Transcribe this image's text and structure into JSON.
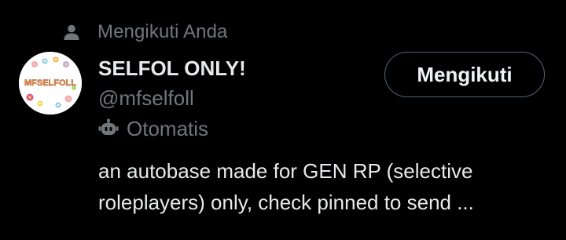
{
  "social_context": {
    "icon": "person-icon",
    "text": "Mengikuti Anda"
  },
  "user": {
    "avatar_text": "MFSELFOLL",
    "display_name": "SELFOL ONLY!",
    "handle": "@mfselfoll",
    "automated_icon": "bot-icon",
    "automated_label": "Otomatis",
    "bio_lines": [
      "an autobase made for GEN RP (selective",
      "roleplayers) only, check pinned to send ..."
    ]
  },
  "follow_button": {
    "label": "Mengikuti"
  },
  "colors": {
    "background": "#000000",
    "primary_text": "#e7e9ea",
    "secondary_text": "#71767b",
    "button_border": "#536471"
  }
}
